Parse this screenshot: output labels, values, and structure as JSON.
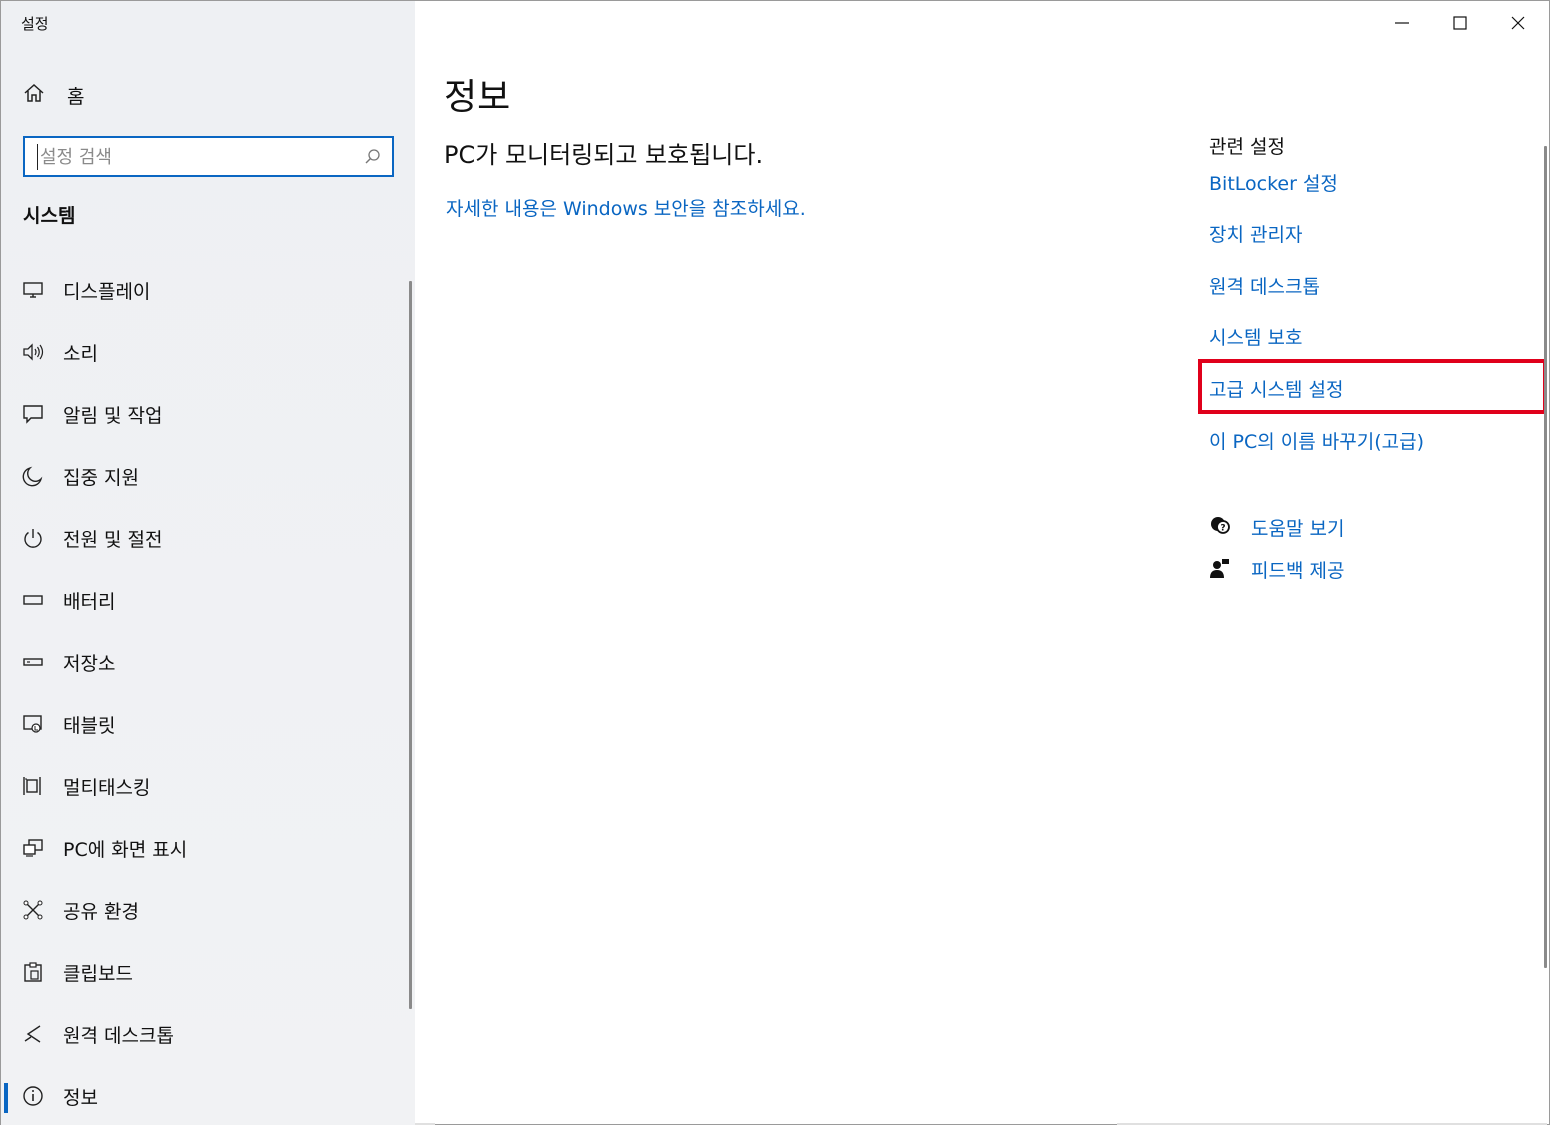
{
  "window": {
    "title": "설정"
  },
  "sidebar": {
    "home_label": "홈",
    "search_placeholder": "설정 검색",
    "section_title": "시스템",
    "items": [
      {
        "label": "디스플레이",
        "icon": "display-icon"
      },
      {
        "label": "소리",
        "icon": "speaker-icon"
      },
      {
        "label": "알림 및 작업",
        "icon": "notification-icon"
      },
      {
        "label": "집중 지원",
        "icon": "moon-icon"
      },
      {
        "label": "전원 및 절전",
        "icon": "power-icon"
      },
      {
        "label": "배터리",
        "icon": "battery-icon"
      },
      {
        "label": "저장소",
        "icon": "storage-icon"
      },
      {
        "label": "태블릿",
        "icon": "tablet-icon"
      },
      {
        "label": "멀티태스킹",
        "icon": "multitasking-icon"
      },
      {
        "label": "PC에 화면 표시",
        "icon": "project-icon"
      },
      {
        "label": "공유 환경",
        "icon": "shared-experiences-icon"
      },
      {
        "label": "클립보드",
        "icon": "clipboard-icon"
      },
      {
        "label": "원격 데스크톱",
        "icon": "remote-desktop-icon"
      },
      {
        "label": "정보",
        "icon": "info-icon",
        "active": true
      }
    ]
  },
  "main": {
    "title": "정보",
    "status": "PC가 모니터링되고 보호됩니다.",
    "security_link": "자세한 내용은 Windows 보안을 참조하세요."
  },
  "related": {
    "title": "관련 설정",
    "links": [
      "BitLocker 설정",
      "장치 관리자",
      "원격 데스크톱",
      "시스템 보호",
      "고급 시스템 설정",
      "이 PC의 이름 바꾸기(고급)"
    ],
    "highlighted": "고급 시스템 설정"
  },
  "help": {
    "get_help": "도움말 보기",
    "feedback": "피드백 제공"
  },
  "colors": {
    "accent": "#0a66c2",
    "highlight_box": "#e0001b"
  }
}
